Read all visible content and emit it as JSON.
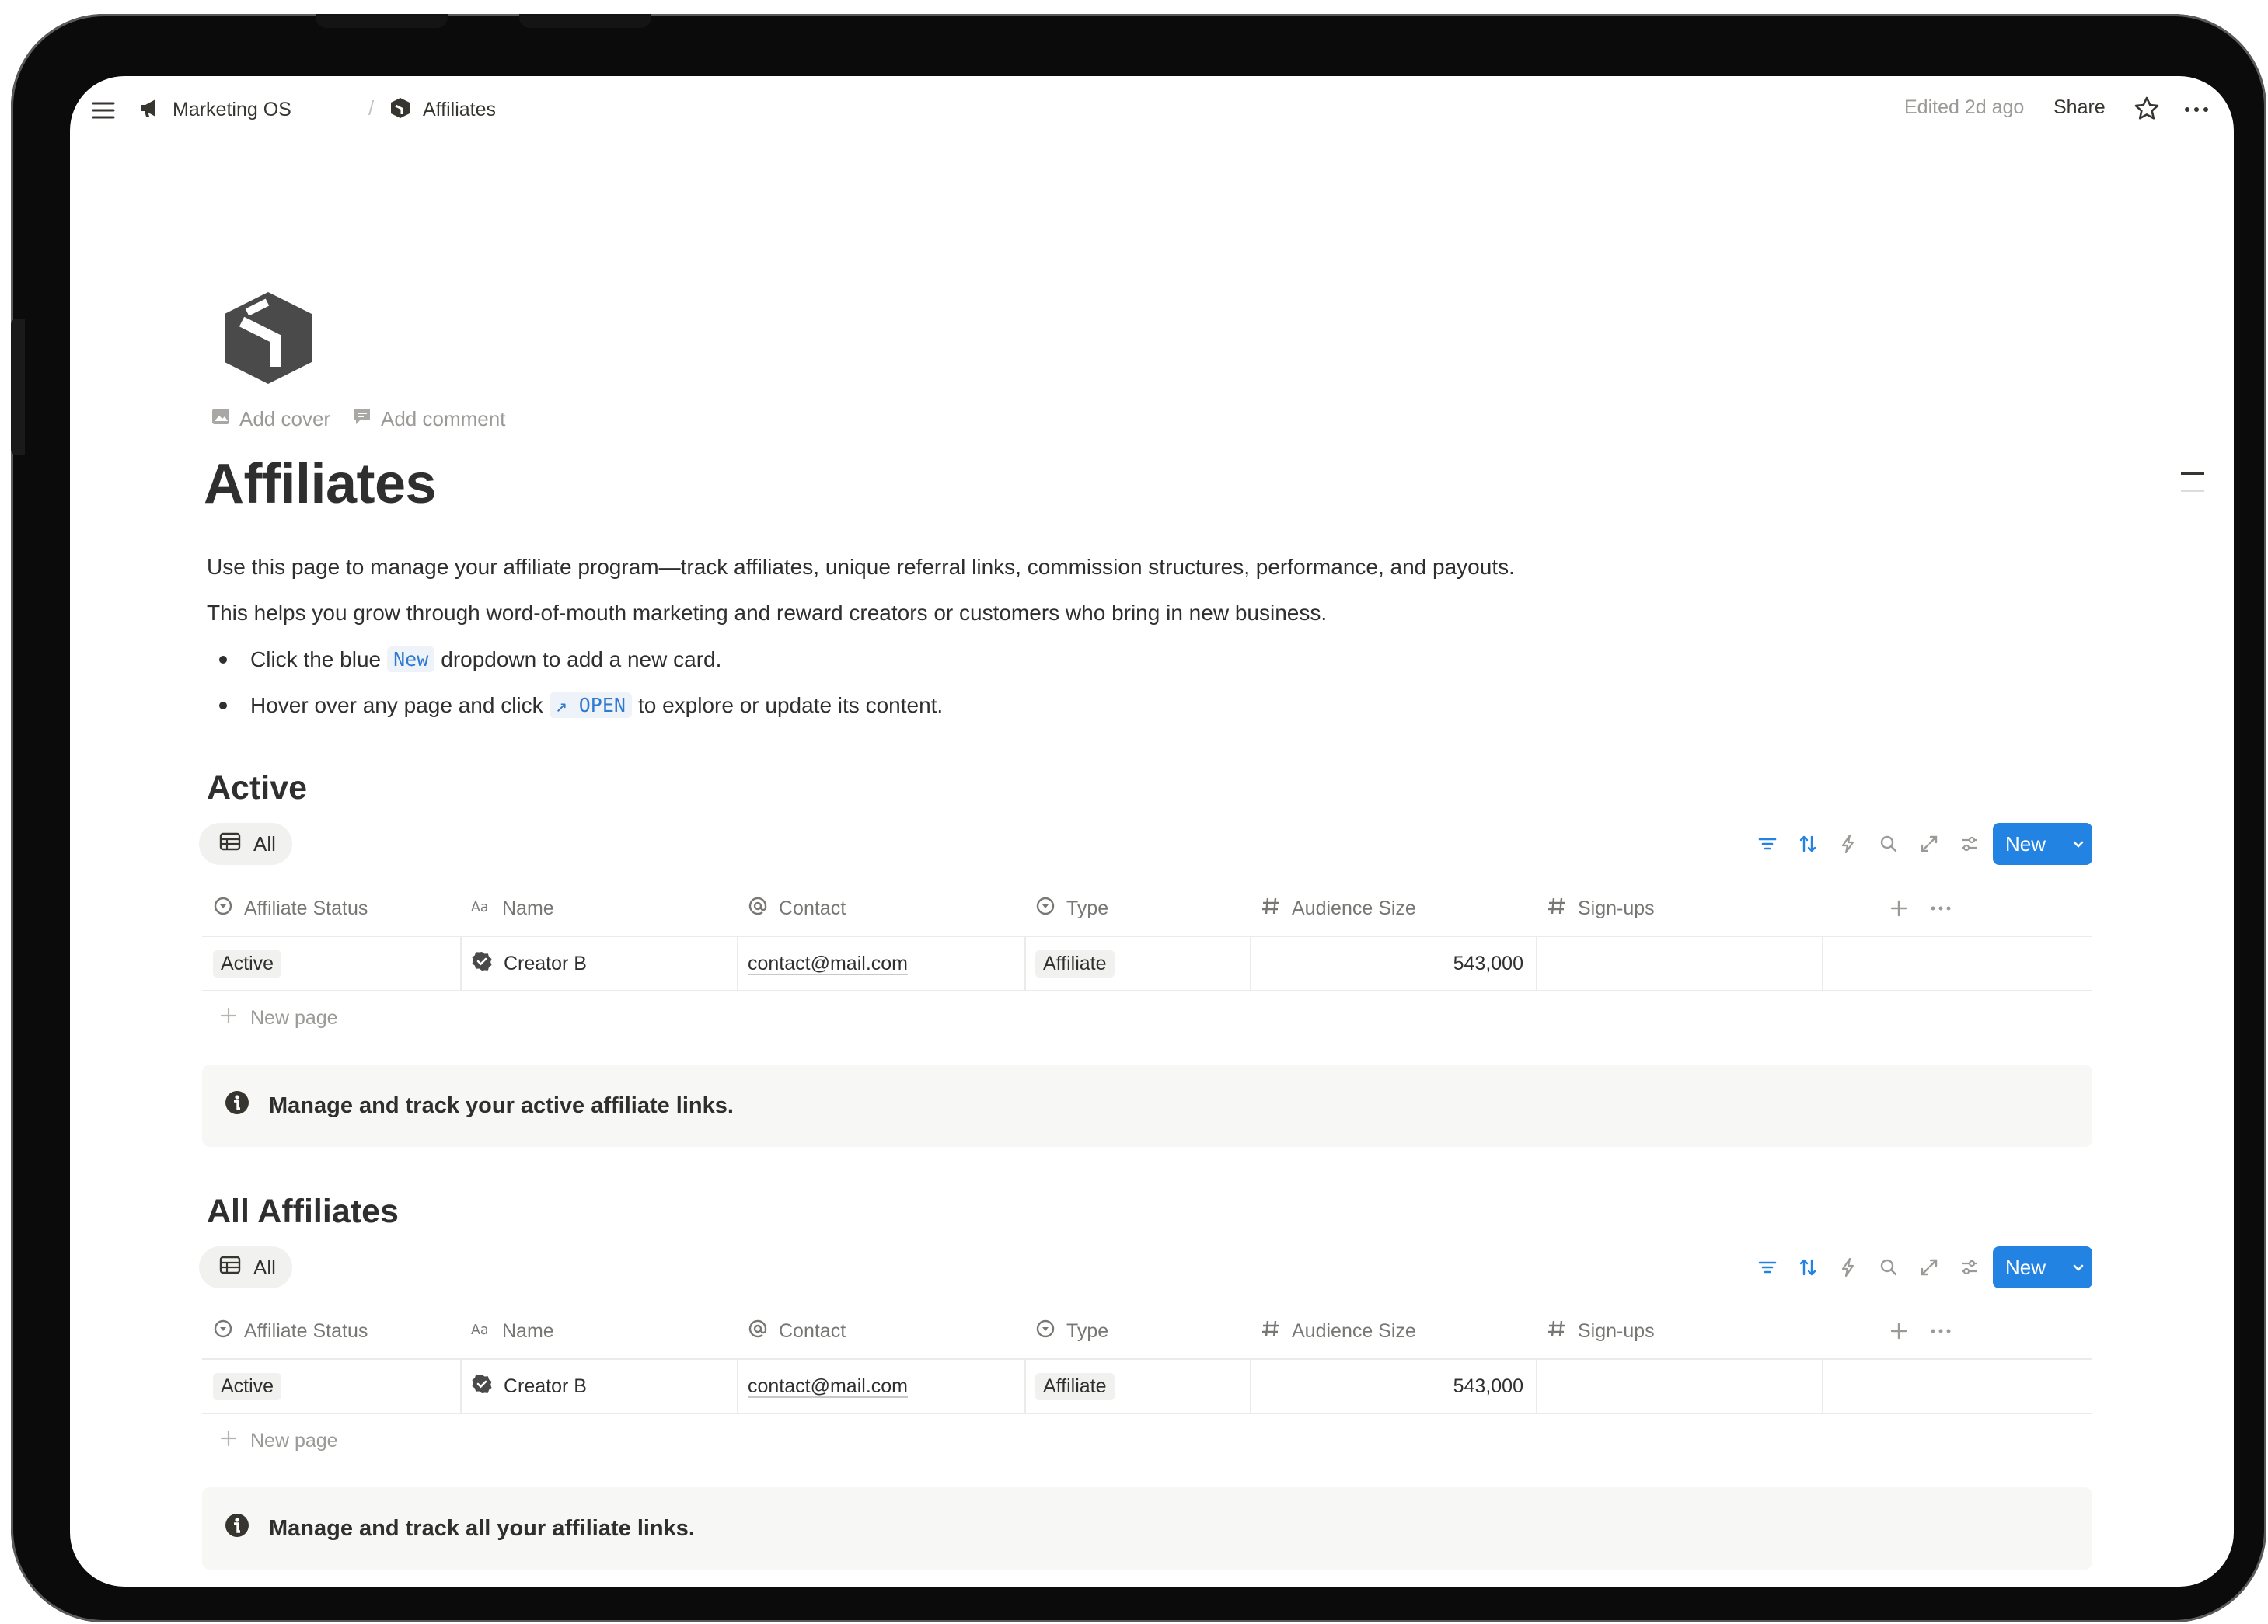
{
  "topbar": {
    "breadcrumbs": [
      {
        "label": "Marketing OS",
        "icon": "megaphone-icon"
      },
      {
        "label": "Affiliates",
        "icon": "cube-icon"
      }
    ],
    "separator": "/",
    "edited": "Edited 2d ago",
    "share": "Share"
  },
  "page": {
    "add_cover": "Add cover",
    "add_comment": "Add comment",
    "title": "Affiliates",
    "description_1": "Use this page to manage your affiliate program—track affiliates, unique referral links, commission structures, performance, and payouts.",
    "description_2": "This helps you grow through word-of-mouth marketing and reward creators or customers who bring in new business.",
    "bullet_1": {
      "before": "Click the blue",
      "code": "New",
      "after": "dropdown to add a new card."
    },
    "bullet_2": {
      "before": "Hover over any page and click",
      "code": "↗ OPEN",
      "after": "to explore or update its content."
    }
  },
  "sections": [
    {
      "heading": "Active",
      "view_tab": "All",
      "new_button": "New",
      "columns": [
        "Affiliate Status",
        "Name",
        "Contact",
        "Type",
        "Audience Size",
        "Sign-ups"
      ],
      "rows": [
        {
          "status": "Active",
          "name": "Creator B",
          "contact": "contact@mail.com",
          "type": "Affiliate",
          "audience": "543,000",
          "signups": ""
        }
      ],
      "new_page": "New page",
      "callout": "Manage and track your active affiliate links."
    },
    {
      "heading": "All Affiliates",
      "view_tab": "All",
      "new_button": "New",
      "columns": [
        "Affiliate Status",
        "Name",
        "Contact",
        "Type",
        "Audience Size",
        "Sign-ups"
      ],
      "rows": [
        {
          "status": "Active",
          "name": "Creator B",
          "contact": "contact@mail.com",
          "type": "Affiliate",
          "audience": "543,000",
          "signups": ""
        }
      ],
      "new_page": "New page",
      "callout": "Manage and track all your affiliate links."
    }
  ],
  "colors": {
    "accent": "#2383e2",
    "text": "#37352f",
    "muted": "#9b9a97",
    "tag_bg": "#f1f1ef"
  }
}
